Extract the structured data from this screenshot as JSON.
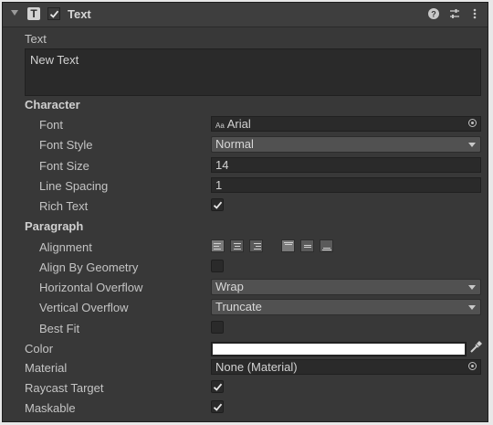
{
  "component": {
    "title": "Text",
    "type_icon": "T",
    "enabled": true,
    "header_icons": [
      "help-icon",
      "presets-icon",
      "more-menu-icon"
    ]
  },
  "text_section": {
    "label": "Text",
    "value": "New Text"
  },
  "character": {
    "heading": "Character",
    "font": {
      "label": "Font",
      "value": "Arial",
      "prefix": "Aa"
    },
    "font_style": {
      "label": "Font Style",
      "value": "Normal"
    },
    "font_size": {
      "label": "Font Size",
      "value": "14"
    },
    "line_spacing": {
      "label": "Line Spacing",
      "value": "1"
    },
    "rich_text": {
      "label": "Rich Text",
      "checked": true
    }
  },
  "paragraph": {
    "heading": "Paragraph",
    "alignment": {
      "label": "Alignment",
      "horizontal": [
        "left",
        "center",
        "right"
      ],
      "vertical": [
        "top",
        "middle",
        "bottom"
      ],
      "selected_horizontal": "left",
      "selected_vertical": "top"
    },
    "align_by_geometry": {
      "label": "Align By Geometry",
      "checked": false
    },
    "horizontal_overflow": {
      "label": "Horizontal Overflow",
      "value": "Wrap"
    },
    "vertical_overflow": {
      "label": "Vertical Overflow",
      "value": "Truncate"
    },
    "best_fit": {
      "label": "Best Fit",
      "checked": false
    }
  },
  "color": {
    "label": "Color",
    "value": "#ffffff"
  },
  "material": {
    "label": "Material",
    "value": "None (Material)"
  },
  "raycast_target": {
    "label": "Raycast Target",
    "checked": true
  },
  "maskable": {
    "label": "Maskable",
    "checked": true
  },
  "theme": {
    "panel_bg": "#383838",
    "field_bg": "#2a2a2a",
    "dropdown_bg": "#515151",
    "text": "#c4c4c4"
  }
}
